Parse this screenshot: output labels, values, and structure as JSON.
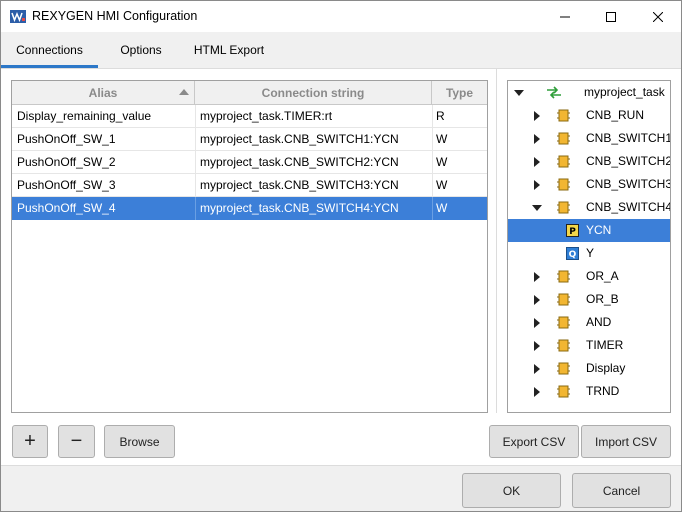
{
  "window": {
    "title": "REXYGEN HMI Configuration"
  },
  "tabs": [
    {
      "label": "Connections",
      "active": true
    },
    {
      "label": "Options",
      "active": false
    },
    {
      "label": "HTML Export",
      "active": false
    }
  ],
  "table": {
    "columns": [
      "Alias",
      "Connection string",
      "Type"
    ],
    "rows": [
      {
        "alias": "Display_remaining_value",
        "connection": "myproject_task.TIMER:rt",
        "type": "R",
        "selected": false
      },
      {
        "alias": "PushOnOff_SW_1",
        "connection": "myproject_task.CNB_SWITCH1:YCN",
        "type": "W",
        "selected": false
      },
      {
        "alias": "PushOnOff_SW_2",
        "connection": "myproject_task.CNB_SWITCH2:YCN",
        "type": "W",
        "selected": false
      },
      {
        "alias": "PushOnOff_SW_3",
        "connection": "myproject_task.CNB_SWITCH3:YCN",
        "type": "W",
        "selected": false
      },
      {
        "alias": "PushOnOff_SW_4",
        "connection": "myproject_task.CNB_SWITCH4:YCN",
        "type": "W",
        "selected": true
      }
    ]
  },
  "tree": {
    "root": "myproject_task",
    "nodes": [
      {
        "label": "CNB_RUN",
        "expanded": false
      },
      {
        "label": "CNB_SWITCH1",
        "expanded": false
      },
      {
        "label": "CNB_SWITCH2",
        "expanded": false
      },
      {
        "label": "CNB_SWITCH3",
        "expanded": false
      },
      {
        "label": "CNB_SWITCH4",
        "expanded": true
      },
      {
        "label": "YCN",
        "child": true,
        "badge": "P",
        "selected": true
      },
      {
        "label": "Y",
        "child": true,
        "badge": "Q"
      },
      {
        "label": "OR_A",
        "expanded": false
      },
      {
        "label": "OR_B",
        "expanded": false
      },
      {
        "label": "AND",
        "expanded": false
      },
      {
        "label": "TIMER",
        "expanded": false
      },
      {
        "label": "Display",
        "expanded": false
      },
      {
        "label": "TRND",
        "expanded": false
      }
    ]
  },
  "buttons": {
    "add": "+",
    "remove": "−",
    "browse": "Browse",
    "export_csv": "Export CSV",
    "import_csv": "Import CSV",
    "ok": "OK",
    "cancel": "Cancel"
  },
  "colors": {
    "selection": "#3c7fd8",
    "tab_underline": "#2d78c8",
    "block_icon": "#f2b632"
  }
}
